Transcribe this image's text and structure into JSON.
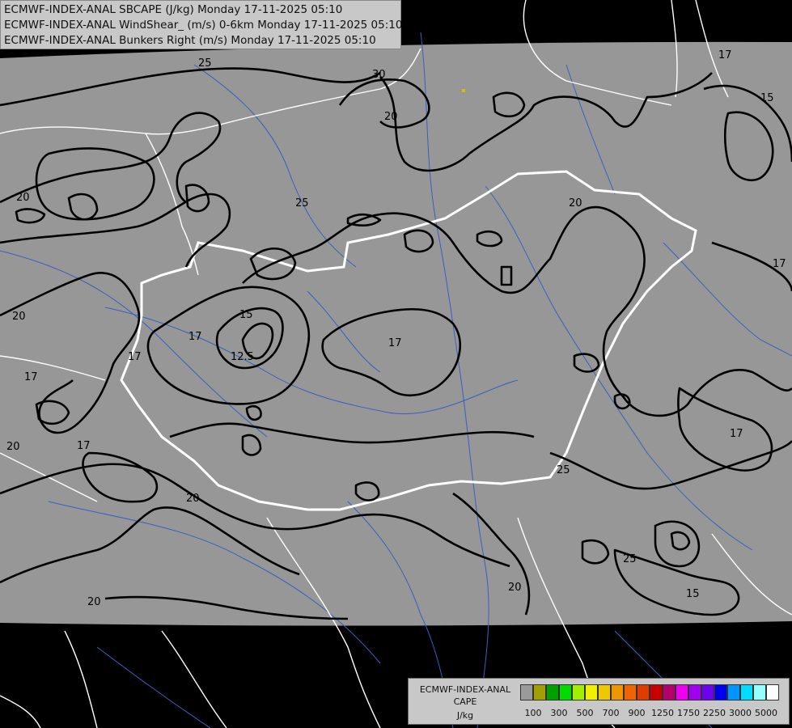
{
  "titles": {
    "line1": "ECMWF-INDEX-ANAL SBCAPE (J/kg) Monday 17-11-2025 05:10",
    "line2": "ECMWF-INDEX-ANAL WindShear_ (m/s) 0-6km Monday 17-11-2025 05:10",
    "line3": "ECMWF-INDEX-ANAL Bunkers Right (m/s) Monday 17-11-2025 05:10"
  },
  "legend": {
    "title1": "ECMWF-INDEX-ANAL",
    "title2": "CAPE",
    "unit": "J/kg",
    "colors": [
      "#9a9a9a",
      "#a0a000",
      "#00a000",
      "#00dc00",
      "#a0f000",
      "#f0f000",
      "#f0c800",
      "#f09600",
      "#f06400",
      "#e03c00",
      "#c80000",
      "#b4006e",
      "#f000f0",
      "#a000f0",
      "#6e00f0",
      "#0000f0",
      "#0096ff",
      "#00dcff",
      "#96ffff",
      "#ffffff"
    ],
    "tick_labels": [
      "100",
      "300",
      "500",
      "700",
      "900",
      "1250",
      "1750",
      "2250",
      "3000",
      "5000"
    ]
  },
  "contour_labels": [
    "25",
    "30",
    "20",
    "17",
    "15",
    "25",
    "20",
    "17",
    "20",
    "17",
    "15",
    "12.5",
    "17",
    "17",
    "17",
    "20",
    "17",
    "20",
    "25",
    "20",
    "17",
    "25",
    "15",
    "20",
    "20"
  ]
}
